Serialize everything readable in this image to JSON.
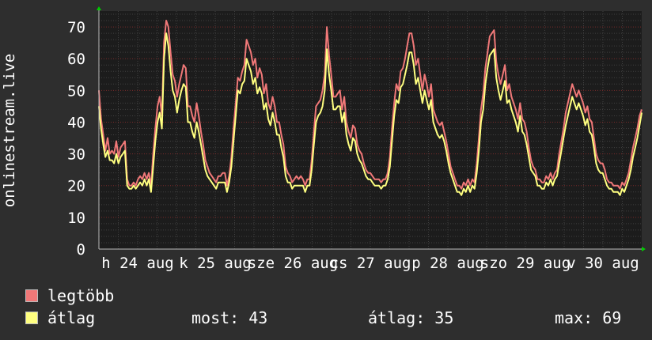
{
  "chart_data": {
    "type": "line",
    "ylabel": "onlinestream.live",
    "ylim": [
      0,
      75
    ],
    "yticks": [
      0,
      10,
      20,
      30,
      40,
      50,
      60,
      70
    ],
    "x_tick_labels": [
      "h 24 aug",
      "k 25 aug",
      "sze 26 aug",
      "cs 27 aug",
      "p 28 aug",
      "szo 29 aug",
      "v 30 aug"
    ],
    "grid": true,
    "series": [
      {
        "name": "legtöbb",
        "color": "#f07878",
        "values": [
          50,
          41,
          36,
          31,
          35,
          30,
          31,
          30,
          34,
          29,
          32,
          33,
          34,
          22,
          20,
          20,
          21,
          20,
          22,
          23,
          22,
          24,
          22,
          24,
          20,
          30,
          38,
          45,
          48,
          42,
          65,
          72,
          70,
          62,
          55,
          53,
          48,
          52,
          55,
          58,
          57,
          45,
          45,
          42,
          40,
          46,
          42,
          37,
          33,
          28,
          26,
          24,
          23,
          22,
          21,
          23,
          23,
          24,
          24,
          20,
          23,
          29,
          38,
          46,
          54,
          53,
          56,
          58,
          66,
          64,
          62,
          58,
          60,
          54,
          57,
          55,
          49,
          52,
          46,
          44,
          48,
          45,
          40,
          40,
          36,
          33,
          26,
          24,
          23,
          21,
          22,
          23,
          22,
          23,
          22,
          20,
          22,
          22,
          28,
          37,
          45,
          46,
          47,
          50,
          55,
          70,
          61,
          55,
          48,
          48,
          49,
          50,
          44,
          48,
          40,
          37,
          35,
          39,
          38,
          33,
          31,
          30,
          27,
          25,
          24,
          24,
          23,
          22,
          22,
          22,
          21,
          22,
          22,
          24,
          29,
          38,
          46,
          52,
          50,
          56,
          57,
          60,
          64,
          68,
          68,
          64,
          58,
          60,
          55,
          50,
          55,
          52,
          48,
          52,
          44,
          42,
          40,
          39,
          40,
          37,
          34,
          30,
          26,
          24,
          22,
          20,
          20,
          19,
          21,
          20,
          22,
          20,
          22,
          21,
          27,
          35,
          44,
          49,
          57,
          62,
          67,
          68,
          69,
          59,
          55,
          52,
          55,
          58,
          50,
          52,
          48,
          46,
          44,
          41,
          46,
          41,
          40,
          37,
          32,
          28,
          26,
          25,
          22,
          22,
          21,
          21,
          23,
          22,
          24,
          22,
          24,
          25,
          30,
          34,
          38,
          43,
          46,
          49,
          52,
          50,
          48,
          50,
          48,
          46,
          43,
          45,
          41,
          40,
          35,
          30,
          28,
          27,
          27,
          25,
          22,
          21,
          21,
          20,
          20,
          20,
          19,
          21,
          20,
          22,
          24,
          28,
          32,
          35,
          38,
          42,
          44
        ]
      },
      {
        "name": "átlag",
        "color": "#ffff80",
        "values": [
          45,
          38,
          33,
          29,
          31,
          28,
          28,
          27,
          30,
          27,
          29,
          30,
          31,
          20,
          19,
          19,
          20,
          19,
          20,
          21,
          20,
          22,
          20,
          22,
          18,
          26,
          34,
          40,
          43,
          38,
          60,
          68,
          64,
          56,
          50,
          48,
          43,
          47,
          50,
          52,
          51,
          40,
          40,
          37,
          35,
          40,
          37,
          33,
          29,
          25,
          23,
          22,
          21,
          20,
          19,
          21,
          21,
          21,
          21,
          18,
          21,
          26,
          34,
          42,
          50,
          49,
          52,
          53,
          60,
          58,
          56,
          52,
          54,
          49,
          51,
          49,
          44,
          46,
          41,
          39,
          43,
          40,
          36,
          36,
          32,
          29,
          23,
          21,
          21,
          19,
          20,
          20,
          20,
          20,
          20,
          18,
          20,
          20,
          25,
          33,
          40,
          42,
          43,
          45,
          50,
          63,
          55,
          50,
          44,
          44,
          45,
          45,
          40,
          43,
          36,
          33,
          31,
          35,
          34,
          30,
          28,
          27,
          25,
          23,
          22,
          22,
          21,
          20,
          20,
          20,
          19,
          20,
          20,
          22,
          26,
          34,
          42,
          47,
          46,
          51,
          52,
          55,
          58,
          62,
          62,
          58,
          52,
          54,
          50,
          46,
          50,
          47,
          44,
          47,
          40,
          38,
          36,
          35,
          36,
          34,
          31,
          27,
          24,
          22,
          20,
          18,
          18,
          17,
          19,
          18,
          20,
          18,
          20,
          19,
          24,
          31,
          40,
          44,
          52,
          57,
          61,
          62,
          63,
          54,
          50,
          47,
          50,
          53,
          46,
          47,
          44,
          42,
          40,
          37,
          42,
          37,
          36,
          33,
          29,
          25,
          24,
          23,
          20,
          20,
          19,
          19,
          21,
          20,
          22,
          20,
          22,
          23,
          27,
          31,
          35,
          39,
          42,
          45,
          48,
          46,
          44,
          46,
          44,
          42,
          39,
          41,
          37,
          36,
          32,
          27,
          25,
          24,
          24,
          22,
          20,
          19,
          19,
          18,
          18,
          18,
          17,
          19,
          18,
          20,
          22,
          25,
          29,
          32,
          35,
          39,
          43
        ]
      }
    ]
  },
  "legend": {
    "items": [
      {
        "label": "legtöbb",
        "color": "#f07878"
      },
      {
        "label": "átlag",
        "color": "#ffff80"
      }
    ],
    "stats": {
      "most": "most: 43",
      "atlag": "átlag: 35",
      "max": "max: 69"
    }
  }
}
